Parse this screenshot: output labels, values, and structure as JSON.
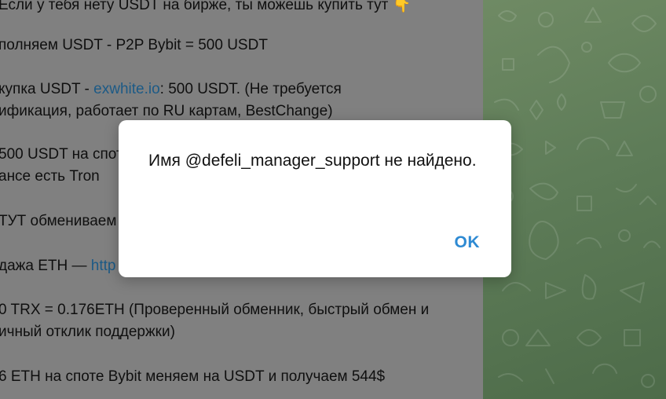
{
  "chat": {
    "lines": [
      {
        "text": "Если у тебя нету USDT на бирже, ты можешь купить тут 👇"
      },
      {
        "text": "полняем USDT - P2P Bybit  = 500 USDT"
      },
      {
        "pre": "купка USDT - ",
        "link": "exwhite.io",
        "post": ": 500 USDT. (Не требуется"
      },
      {
        "text": "ификация, работает по RU картам, BestChange)"
      },
      {
        "text": "500 USDT на спот"
      },
      {
        "text": "ансе есть Tron"
      },
      {
        "text": "ТУТ обмениваем"
      },
      {
        "pre": "дажа ETH — ",
        "link": "http"
      },
      {
        "text": "0 TRX = 0.176ETH (Проверенный обменник, быстрый обмен и"
      },
      {
        "text": "ичный отклик поддержки)"
      },
      {
        "text": "6 ETH на споте Bybit меняем на USDT и получаем 544$"
      }
    ]
  },
  "dialog": {
    "message": "Имя @defeli_manager_support не найдено.",
    "ok_label": "OK"
  },
  "colors": {
    "link": "#1c5a86",
    "accent": "#2e8ad3",
    "wallpaper": "#5e7c58"
  }
}
